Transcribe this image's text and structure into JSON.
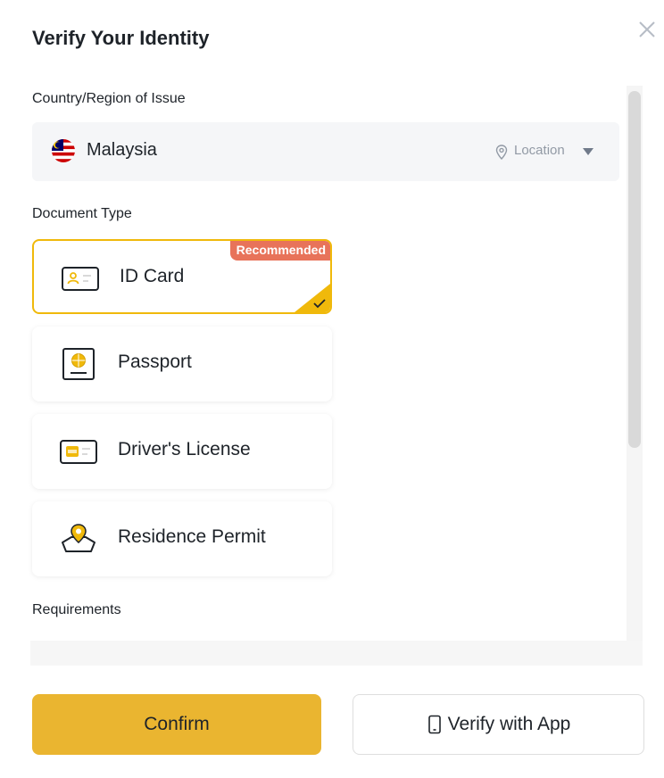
{
  "dialog": {
    "title": "Verify Your Identity"
  },
  "country": {
    "section_label": "Country/Region of Issue",
    "selected": "Malaysia",
    "location_label": "Location"
  },
  "document_type": {
    "section_label": "Document Type",
    "recommended_badge": "Recommended",
    "options": [
      {
        "label": "ID Card",
        "icon": "id-card-icon",
        "selected": true
      },
      {
        "label": "Passport",
        "icon": "passport-icon",
        "selected": false
      },
      {
        "label": "Driver's License",
        "icon": "drivers-license-icon",
        "selected": false
      },
      {
        "label": "Residence Permit",
        "icon": "residence-permit-icon",
        "selected": false
      }
    ]
  },
  "requirements": {
    "section_label": "Requirements"
  },
  "footer": {
    "confirm_label": "Confirm",
    "verify_app_label": "Verify with App"
  },
  "colors": {
    "accent": "#F0B90B",
    "button": "#EAB530",
    "badge": "#E8735A"
  }
}
